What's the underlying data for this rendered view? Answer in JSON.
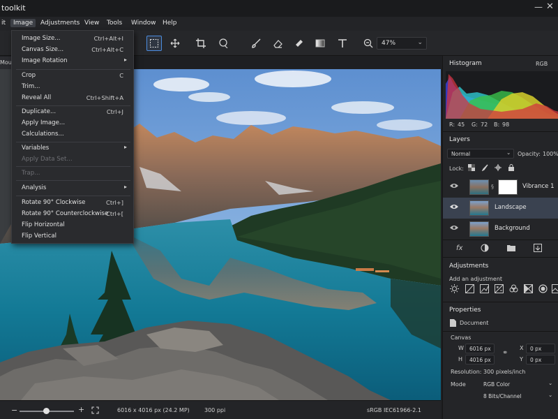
{
  "app": {
    "title": "toolkit"
  },
  "menubar": {
    "items": [
      "it",
      "Image",
      "Adjustments",
      "View",
      "Tools",
      "Window",
      "Help"
    ],
    "active": "Image"
  },
  "toolbar": {
    "tools": [
      "marquee-select",
      "move",
      "crop",
      "lasso",
      "brush",
      "eraser",
      "healing",
      "gradient",
      "text",
      "zoom"
    ],
    "zoom_value": "47%"
  },
  "document_tab": {
    "label": "Mou"
  },
  "image_menu": {
    "items": [
      {
        "label": "Image Size...",
        "shortcut": "Ctrl+Alt+I"
      },
      {
        "label": "Canvas Size...",
        "shortcut": "Ctrl+Alt+C"
      },
      {
        "label": "Image Rotation",
        "submenu": "▸"
      },
      {
        "label": "Crop",
        "shortcut": "C"
      },
      {
        "label": "Trim..."
      },
      {
        "label": "Reveal All",
        "shortcut": "Ctrl+Shift+A"
      },
      {
        "label": "Duplicate...",
        "shortcut": "Ctrl+J"
      },
      {
        "label": "Apply Image..."
      },
      {
        "label": "Calculations..."
      },
      {
        "label": "Variables",
        "submenu": "▸"
      },
      {
        "label": "Apply Data Set...",
        "disabled": true
      },
      {
        "label": "Trap...",
        "disabled": true
      },
      {
        "label": "Analysis",
        "submenu": "▸"
      },
      {
        "label": "Rotate 90° Clockwise",
        "shortcut": "Ctrl+]"
      },
      {
        "label": "Rotate 90° Counterclockwise",
        "shortcut": "Ctrl+["
      },
      {
        "label": "Flip Horizontal"
      },
      {
        "label": "Flip Vertical"
      }
    ]
  },
  "status": {
    "zoom_minus": "−",
    "zoom_plus": "+",
    "dimensions": "6016 x 4016 px (24.2 MP)",
    "resolution": "300 ppi",
    "color_profile": "sRGB IEC61966-2.1"
  },
  "histogram": {
    "title": "Histogram",
    "channel": "RGB",
    "r_label": "R:",
    "r": "45",
    "g_label": "G:",
    "g": "72",
    "b_label": "B:",
    "b": "98"
  },
  "layers": {
    "title": "Layers",
    "blend_mode": "Normal",
    "opacity_label": "Opacity:",
    "opacity": "100%",
    "lock_label": "Lock:",
    "items": [
      {
        "name": "Vibrance 1"
      },
      {
        "name": "Landscape",
        "selected": true
      },
      {
        "name": "Background"
      }
    ],
    "fx_label": "fx"
  },
  "adjustments": {
    "title": "Adjustments",
    "subtitle": "Add an adjustment"
  },
  "properties": {
    "title": "Properties",
    "type": "Document",
    "canvas_label": "Canvas",
    "w_label": "W",
    "w": "6016 px",
    "h_label": "H",
    "h": "4016 px",
    "x_label": "X",
    "x": "0 px",
    "y_label": "Y",
    "y": "0 px",
    "resolution_label": "Resolution:",
    "resolution": "300 pixels/inch",
    "mode_label": "Mode",
    "mode": "RGB Color",
    "bits": "8 Bits/Channel"
  },
  "colors": {
    "accent": "#4c8de0",
    "selected_layer": "#3a4250"
  }
}
